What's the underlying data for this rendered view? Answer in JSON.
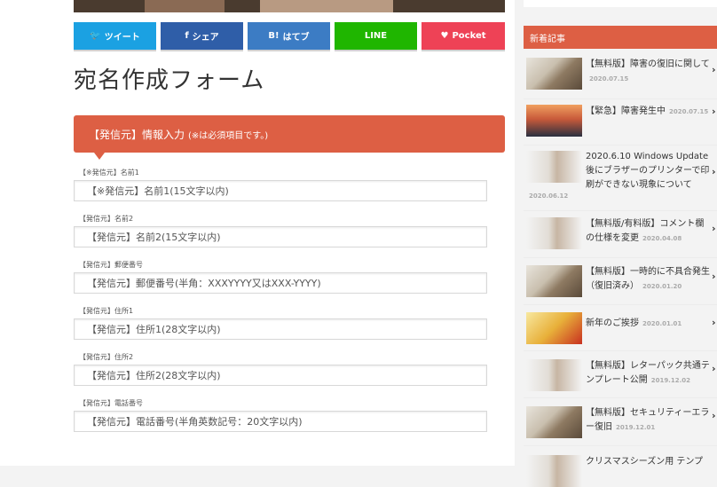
{
  "share": {
    "twitter": "ツイート",
    "facebook": "シェア",
    "hatena": "はてブ",
    "hatena_mark": "B!",
    "line": "LINE",
    "pocket": "Pocket",
    "colors": {
      "twitter": "#1ba1e2",
      "facebook": "#2f5ea8",
      "hatena": "#3c7cc4",
      "line": "#1fb600",
      "pocket": "#ee4256"
    }
  },
  "page_title": "宛名作成フォーム",
  "panel": {
    "title": "【発信元】情報入力",
    "note": "(※は必須項目です。)",
    "color": "#dd5f44"
  },
  "fields": [
    {
      "label": "【※発信元】名前1",
      "placeholder": "【※発信元】名前1(15文字以内)"
    },
    {
      "label": "【発信元】名前2",
      "placeholder": "【発信元】名前2(15文字以内)"
    },
    {
      "label": "【発信元】郵便番号",
      "placeholder": "【発信元】郵便番号(半角：XXXYYYY又はXXX-YYYY)"
    },
    {
      "label": "【発信元】住所1",
      "placeholder": "【発信元】住所1(28文字以内)"
    },
    {
      "label": "【発信元】住所2",
      "placeholder": "【発信元】住所2(28文字以内)"
    },
    {
      "label": "【発信元】電話番号",
      "placeholder": "【発信元】電話番号(半角英数記号：20文字以内)"
    }
  ],
  "sidebar": {
    "heading": "新着記事",
    "posts": [
      {
        "title": "【無料版】障害の復旧に関して",
        "date": "2020.07.15"
      },
      {
        "title": "【緊急】障害発生中",
        "date": "2020.07.15"
      },
      {
        "title": "2020.6.10 Windows Update後にブラザーのプリンターで印刷ができない現象について",
        "date": "2020.06.12"
      },
      {
        "title": "【無料版/有料版】コメント欄の仕様を変更",
        "date": "2020.04.08"
      },
      {
        "title": "【無料版】一時的に不具合発生（復旧済み）",
        "date": "2020.01.20"
      },
      {
        "title": "新年のご挨拶",
        "date": "2020.01.01"
      },
      {
        "title": "【無料版】レターパック共通テンプレート公開",
        "date": "2019.12.02"
      },
      {
        "title": "【無料版】セキュリティーエラー復旧",
        "date": "2019.12.01"
      },
      {
        "title": "クリスマスシーズン用 テンプ",
        "date": ""
      }
    ]
  }
}
